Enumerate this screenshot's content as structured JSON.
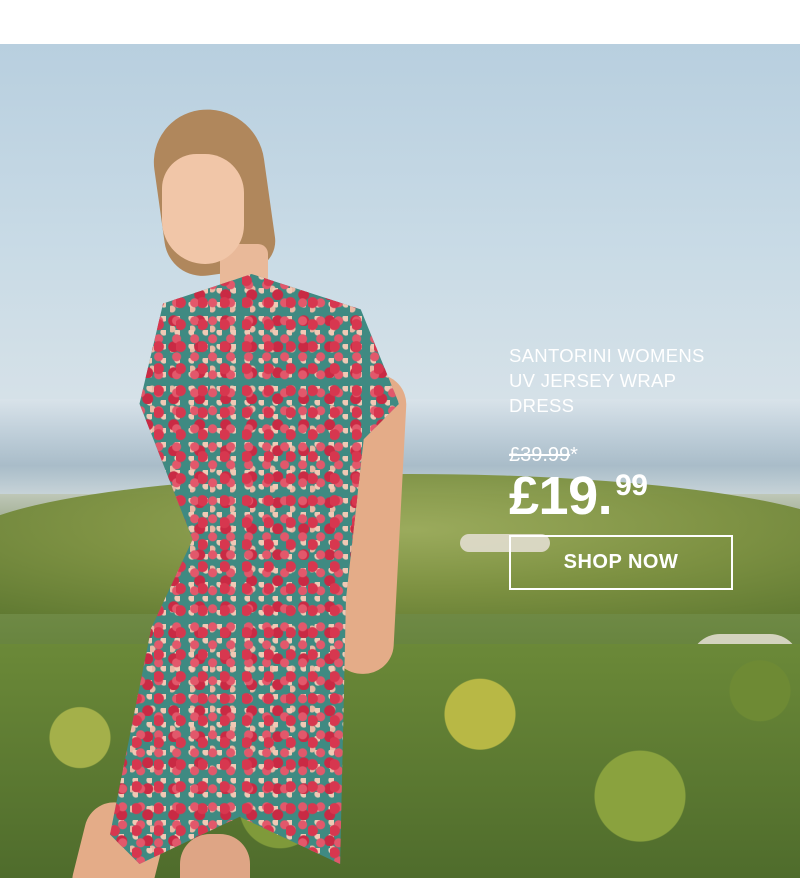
{
  "hero": {
    "image_icon": "woman-in-floral-wrap-dress-photo"
  },
  "product": {
    "name_lines": [
      "SANTORINI WOMENS",
      "UV JERSEY WRAP",
      "DRESS"
    ],
    "was_price": "£39.99",
    "was_price_marker": "*",
    "now_price_pounds": "£19.",
    "now_price_pence": "99"
  },
  "cta": {
    "label": "SHOP NOW"
  },
  "colors": {
    "text": "#ffffff",
    "button_border": "#ffffff"
  }
}
